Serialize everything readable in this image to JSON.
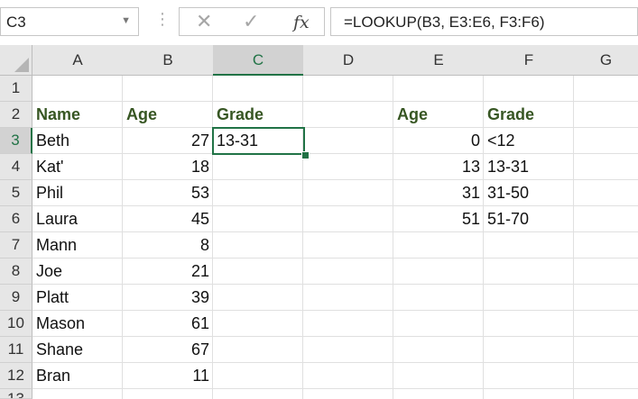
{
  "formula_bar": {
    "name_box": "C3",
    "cancel_icon": "✕",
    "enter_icon": "✓",
    "fx_label": "fx",
    "formula": "=LOOKUP(B3, E3:E6, F3:F6)"
  },
  "columns": [
    "A",
    "B",
    "C",
    "D",
    "E",
    "F",
    "G"
  ],
  "rows": [
    "1",
    "2",
    "3",
    "4",
    "5",
    "6",
    "7",
    "8",
    "9",
    "10",
    "11",
    "12",
    "13"
  ],
  "selected": {
    "column": "C",
    "row": "3",
    "cell": "C3"
  },
  "headers": {
    "A2": "Name",
    "B2": "Age",
    "C2": "Grade",
    "E2": "Age",
    "F2": "Grade"
  },
  "people": [
    {
      "name": "Beth",
      "age": "27",
      "grade": "13-31"
    },
    {
      "name": "Kat'",
      "age": "18",
      "grade": ""
    },
    {
      "name": "Phil",
      "age": "53",
      "grade": ""
    },
    {
      "name": "Laura",
      "age": "45",
      "grade": ""
    },
    {
      "name": "Mann",
      "age": "8",
      "grade": ""
    },
    {
      "name": "Joe",
      "age": "21",
      "grade": ""
    },
    {
      "name": "Platt",
      "age": "39",
      "grade": ""
    },
    {
      "name": "Mason",
      "age": "61",
      "grade": ""
    },
    {
      "name": "Shane",
      "age": "67",
      "grade": ""
    },
    {
      "name": "Bran",
      "age": "11",
      "grade": ""
    }
  ],
  "lookup_table": [
    {
      "age": "0",
      "grade": "<12"
    },
    {
      "age": "13",
      "grade": "13-31"
    },
    {
      "age": "31",
      "grade": "31-50"
    },
    {
      "age": "51",
      "grade": "51-70"
    }
  ],
  "colors": {
    "accent": "#217346",
    "header_text": "#375623"
  }
}
